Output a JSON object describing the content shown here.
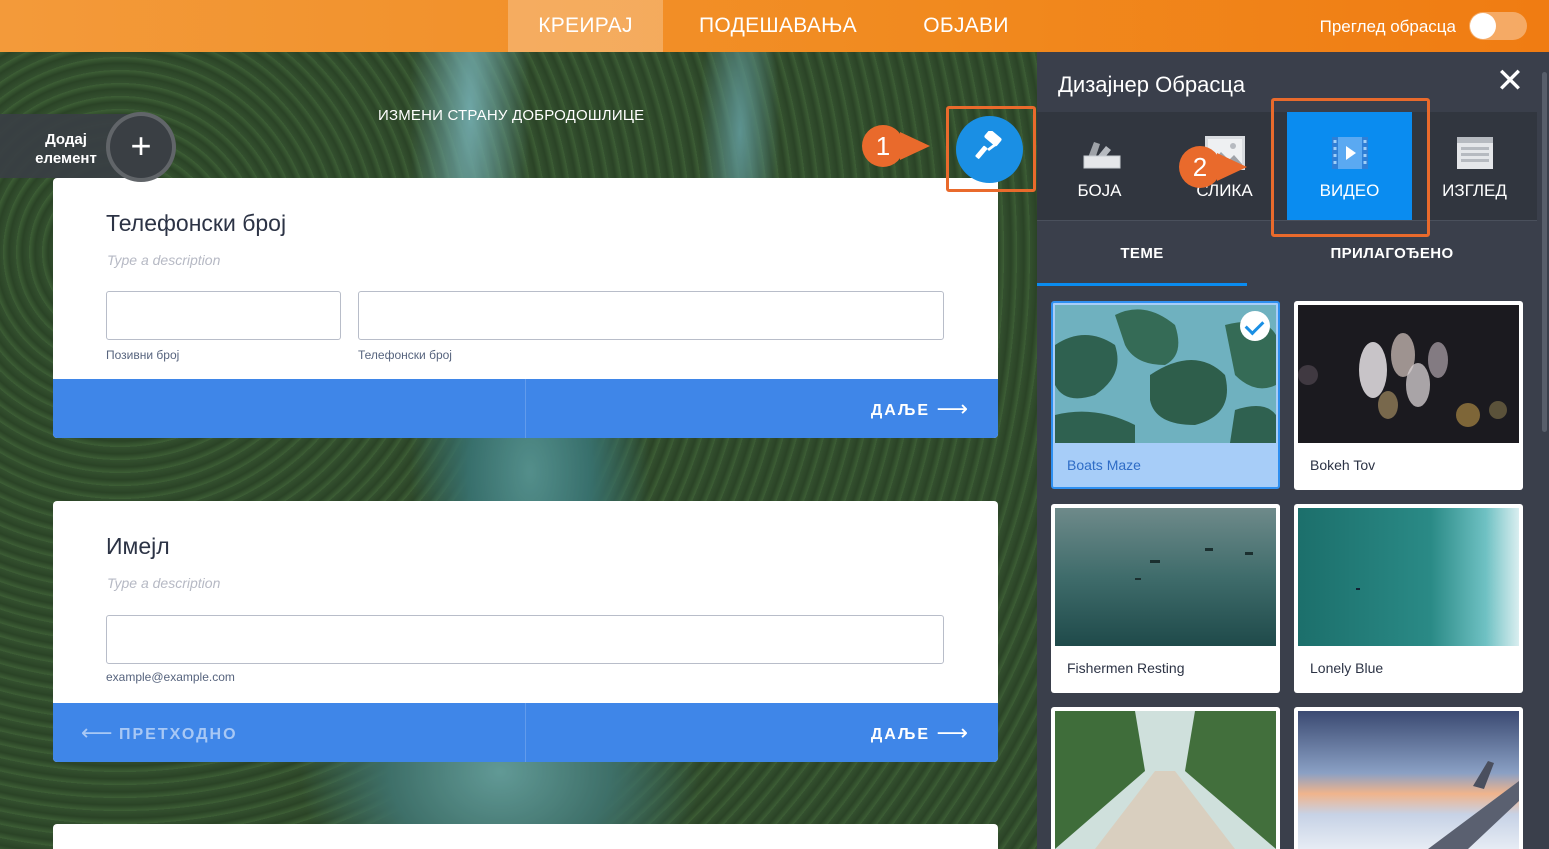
{
  "topbar": {
    "tabs": [
      "КРЕИРАЈ",
      "ПОДЕШАВАЊА",
      "ОБЈАВИ"
    ],
    "active_tab": "КРЕИРАЈ",
    "preview_label": "Преглед обрасца",
    "preview_toggle_on": false,
    "accent_color": "#f18a1f"
  },
  "canvas": {
    "add_element_label": "Додај елемент",
    "add_element_icon": "plus-icon",
    "edit_welcome": "ИЗМЕНИ СТРАНУ ДОБРОДОШЛИЦЕ",
    "designer_button_icon": "paint-roller-icon",
    "callouts": [
      "1",
      "2"
    ]
  },
  "form": {
    "phone": {
      "title": "Телефонски број",
      "description_placeholder": "Type a description",
      "area_code_sublabel": "Позивни број",
      "phone_sublabel": "Телефонски број",
      "next_label": "ДАЉЕ"
    },
    "email": {
      "title": "Имејл",
      "description_placeholder": "Type a description",
      "sublabel": "example@example.com",
      "prev_label": "ПРЕТХОДНО",
      "next_label": "ДАЉЕ"
    },
    "button_color": "#3f86e8"
  },
  "designer": {
    "title": "Дизајнер Обрасца",
    "close_icon": "close-icon",
    "tabs": [
      {
        "label": "БОЈА",
        "icon": "color-palette-icon"
      },
      {
        "label": "СЛИКА",
        "icon": "image-icon"
      },
      {
        "label": "ВИДЕО",
        "icon": "video-icon"
      },
      {
        "label": "ИЗГЛЕД",
        "icon": "layout-icon"
      }
    ],
    "active_tab": "ВИДЕО",
    "subtabs": [
      "ТЕМЕ",
      "ПРИЛАГОЂЕНО"
    ],
    "active_subtab": "ТЕМЕ",
    "videos": [
      {
        "name": "Boats Maze",
        "selected": true
      },
      {
        "name": "Bokeh Tov",
        "selected": false
      },
      {
        "name": "Fishermen Resting",
        "selected": false
      },
      {
        "name": "Lonely Blue",
        "selected": false
      },
      {
        "name": "",
        "selected": false
      },
      {
        "name": "",
        "selected": false
      }
    ],
    "active_color": "#0a8cf0"
  }
}
